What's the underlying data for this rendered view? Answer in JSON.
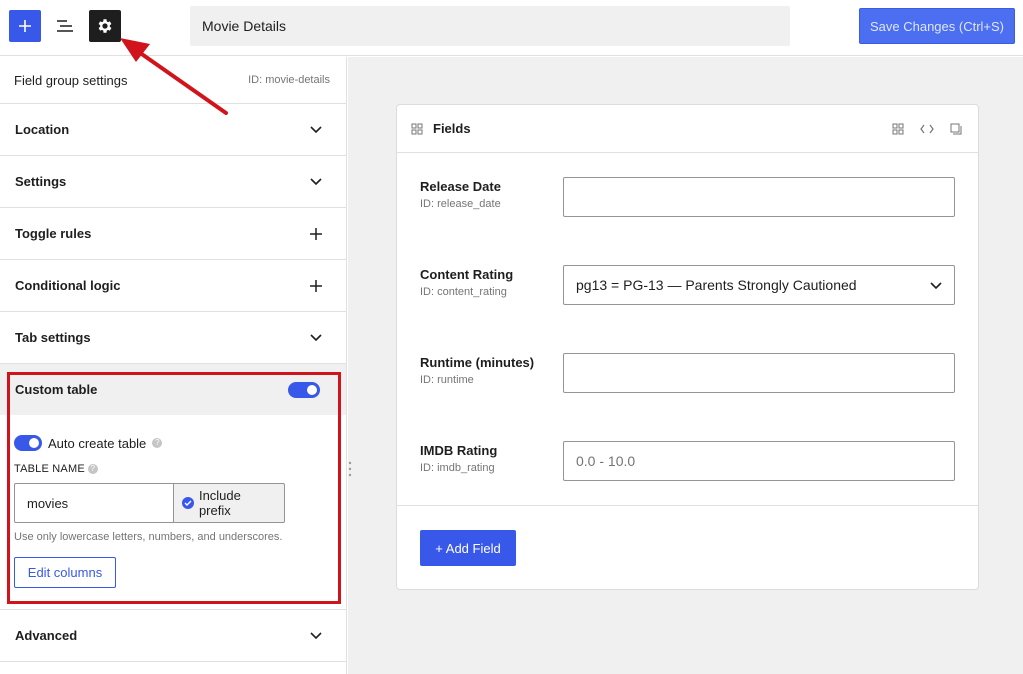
{
  "toolbar": {
    "add_label": "+",
    "title_value": "Movie Details",
    "save_label": "Save Changes (Ctrl+S)",
    "icons": [
      "plus-icon",
      "list-view-icon",
      "gear-icon"
    ]
  },
  "sidebar": {
    "header_title": "Field group settings",
    "header_id": "ID: movie-details",
    "panels": [
      {
        "label": "Location",
        "icon": "chevron-down-icon"
      },
      {
        "label": "Settings",
        "icon": "chevron-down-icon"
      },
      {
        "label": "Toggle rules",
        "icon": "plus-icon"
      },
      {
        "label": "Conditional logic",
        "icon": "plus-icon"
      },
      {
        "label": "Tab settings",
        "icon": "chevron-down-icon"
      }
    ],
    "custom_table": {
      "label": "Custom table",
      "enabled": true,
      "auto_create_label": "Auto create table",
      "table_name_label": "TABLE NAME",
      "table_name_value": "movies",
      "include_prefix_label": "Include prefix",
      "hint": "Use only lowercase letters, numbers, and underscores.",
      "edit_columns_label": "Edit columns"
    },
    "advanced_label": "Advanced"
  },
  "main": {
    "card_title": "Fields",
    "fields": [
      {
        "name": "Release Date",
        "id": "ID: release_date",
        "value": "",
        "placeholder": ""
      },
      {
        "name": "Content Rating",
        "id": "ID: content_rating",
        "value": "pg13 = PG-13 — Parents Strongly Cautioned",
        "type": "select"
      },
      {
        "name": "Runtime (minutes)",
        "id": "ID: runtime",
        "value": "",
        "placeholder": ""
      },
      {
        "name": "IMDB Rating",
        "id": "ID: imdb_rating",
        "value": "",
        "placeholder": "0.0 - 10.0"
      }
    ],
    "add_field_label": "+ Add Field"
  },
  "colors": {
    "accent": "#3858e9",
    "annotation_red": "#d1141b"
  }
}
